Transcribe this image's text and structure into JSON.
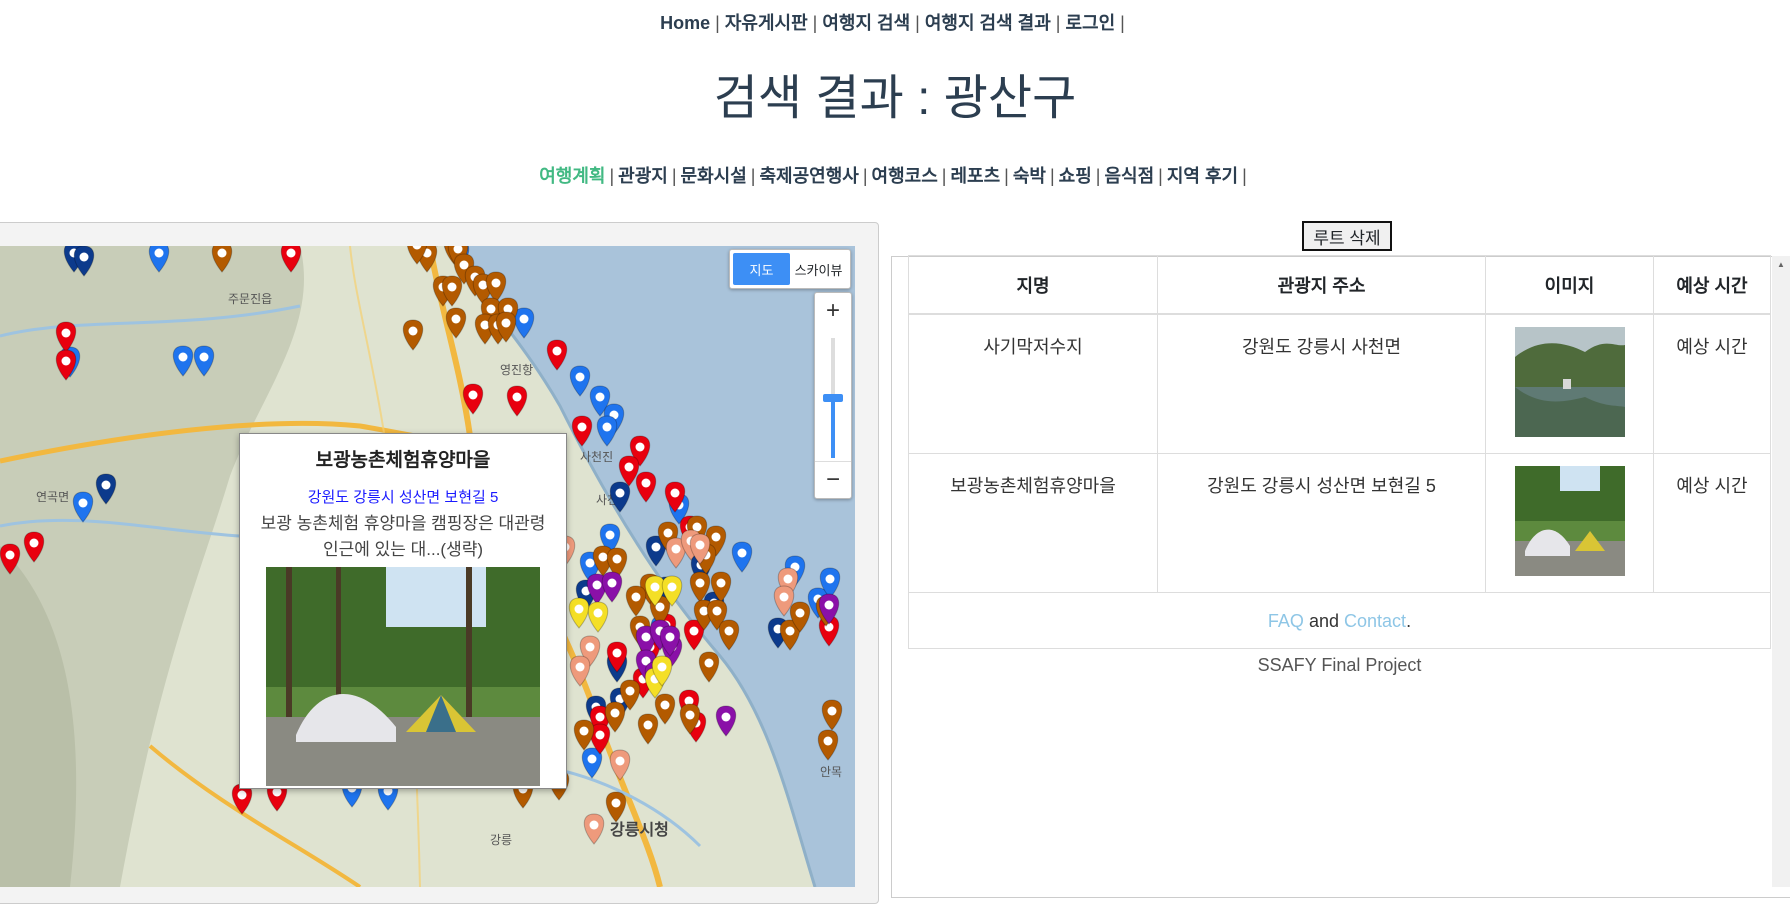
{
  "nav": {
    "home": "Home",
    "board": "자유게시판",
    "search": "여행지 검색",
    "results": "여행지 검색 결과",
    "login": "로그인",
    "sep": "|"
  },
  "page_title": "검색 결과 : 광산구",
  "categories": [
    "여행계획",
    "관광지",
    "문화시설",
    "축제공연행사",
    "여행코스",
    "레포츠",
    "숙박",
    "쇼핑",
    "음식점",
    "지역 후기"
  ],
  "map": {
    "type_map": "지도",
    "type_sky": "스카이뷰",
    "zoom_in": "+",
    "zoom_out": "−",
    "zoom_level_fraction": 0.5,
    "labels": [
      "주문진읍",
      "영진항",
      "연곡면",
      "사천진",
      "사천",
      "강릉시청",
      "강릉",
      "안목"
    ],
    "marker_colors": {
      "red": "#e8000f",
      "blue": "#1f74ee",
      "navy": "#0c3a8c",
      "brown": "#b35a00",
      "purple": "#8a10a8",
      "yellow": "#f4df26",
      "salmon": "#ee9a7c"
    },
    "info": {
      "name": "보광농촌체험휴양마을",
      "address": "강원도 강릉시 성산면 보현길 5",
      "desc": "보광 농촌체험 휴양마을 캠핑장은 대관령 인근에 있는 대...(생략)"
    }
  },
  "route": {
    "delete_button": "루트 삭제",
    "headers": [
      "지명",
      "관광지 주소",
      "이미지",
      "예상 시간"
    ],
    "rows": [
      {
        "name": "사기막저수지",
        "address": "강원도 강릉시 사천면",
        "time": "예상 시간"
      },
      {
        "name": "보광농촌체험휴양마을",
        "address": "강원도 강릉시 성산면 보현길 5",
        "time": "예상 시간"
      }
    ],
    "footer": {
      "faq": "FAQ",
      "and": "and",
      "contact": "Contact",
      "period": "."
    },
    "credit": "SSAFY Final Project"
  }
}
